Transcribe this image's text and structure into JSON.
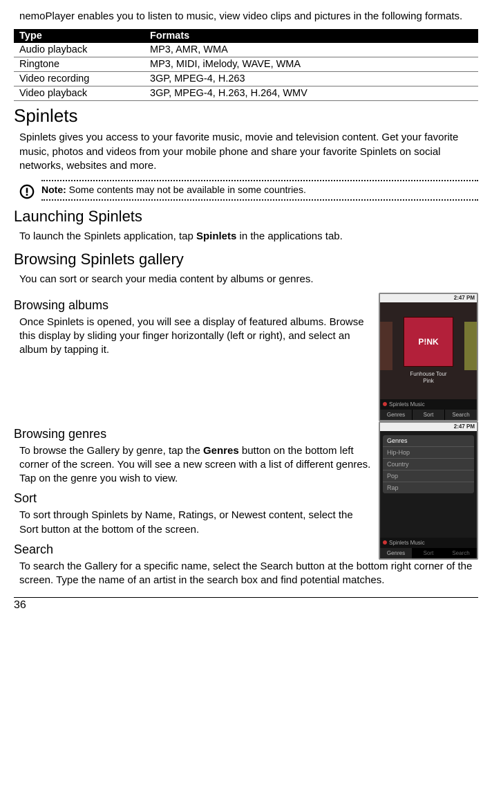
{
  "intro": "nemoPlayer enables you to listen to music, view video clips and pictures in the following formats.",
  "table": {
    "headers": [
      "Type",
      "Formats"
    ],
    "rows": [
      [
        "Audio playback",
        "MP3, AMR, WMA"
      ],
      [
        "Ringtone",
        "MP3, MIDI, iMelody, WAVE, WMA"
      ],
      [
        "Video recording",
        "3GP, MPEG-4, H.263"
      ],
      [
        "Video playback",
        "3GP, MPEG-4, H.263, H.264, WMV"
      ]
    ]
  },
  "spinlets": {
    "heading": "Spinlets",
    "intro": "Spinlets gives you access to your favorite music, movie and television content. Get your favorite music, photos and videos from your mobile phone and share your favorite Spinlets on social networks, websites and more.",
    "note_label": "Note:",
    "note_text": " Some contents may not be available in some countries.",
    "launch": {
      "heading": "Launching Spinlets",
      "pre": "To launch the Spinlets application, tap ",
      "bold": "Spinlets",
      "post": " in the applications tab."
    },
    "gallery": {
      "heading": "Browsing Spinlets gallery",
      "intro": "You can sort or search your media content by albums or genres."
    },
    "albums": {
      "heading": "Browsing albums",
      "text": "Once Spinlets is opened, you will see a display of featured albums. Browse this display by sliding your finger horizontally (left or right), and select an album by tapping it."
    },
    "genres": {
      "heading": "Browsing genres",
      "pre": "To browse the Gallery by genre, tap the ",
      "bold": "Genres",
      "post": " button on the bottom left corner of the screen. You will see a new screen with a list of different genres. Tap on the genre you wish to view."
    },
    "sort": {
      "heading": "Sort",
      "text": "To sort through Spinlets by Name, Ratings, or Newest content, select the Sort button at the bottom of the screen."
    },
    "search": {
      "heading": "Search",
      "text": "To search the Gallery for a specific name, select the Search button at the bottom right corner of the screen. Type the name of an artist in the search box and find potential matches."
    }
  },
  "screenshot1": {
    "time": "2:47 PM",
    "album_label": "P!NK",
    "album_title": "Funhouse Tour",
    "album_artist": "Pink",
    "brand": "Spinlets  Music",
    "tabs": [
      "Genres",
      "Sort",
      "Search"
    ]
  },
  "screenshot2": {
    "time": "2:47 PM",
    "panel_header": "Genres",
    "items": [
      "Hip-Hop",
      "Country",
      "Pop",
      "Rap"
    ],
    "brand": "Spinlets  Music",
    "tabs": [
      "Genres",
      "Sort",
      "Search"
    ]
  },
  "page_number": "36"
}
